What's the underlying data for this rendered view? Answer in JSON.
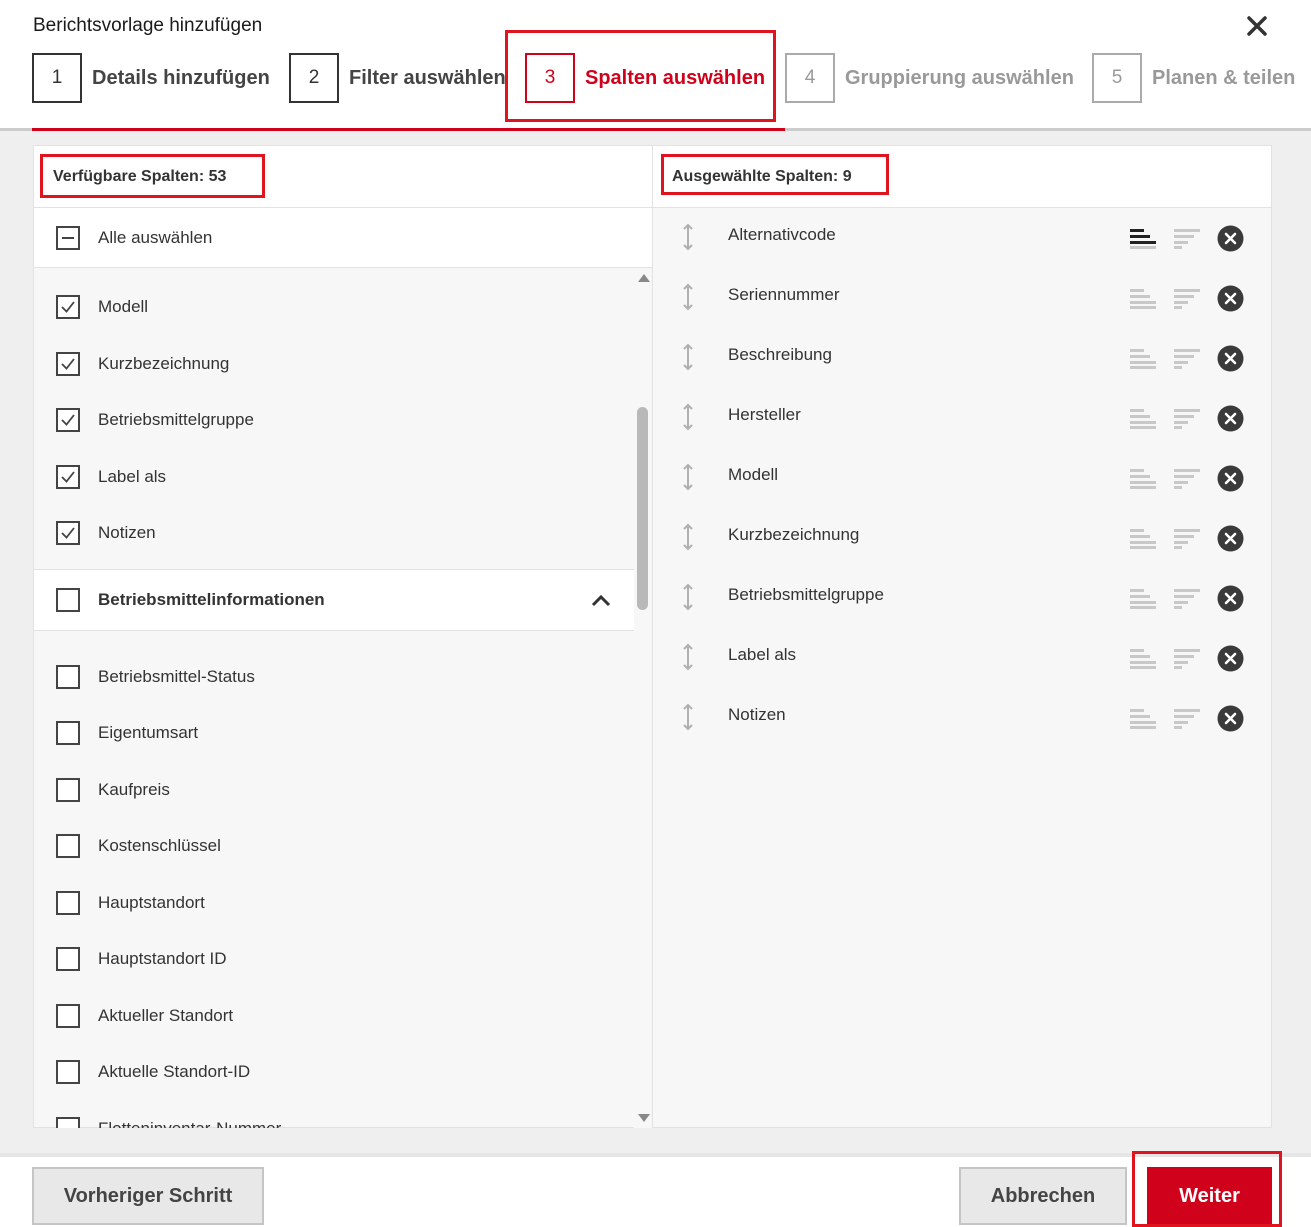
{
  "dialog": {
    "title": "Berichtsvorlage hinzufügen"
  },
  "steps": [
    {
      "num": "1",
      "label": "Details hinzufügen"
    },
    {
      "num": "2",
      "label": "Filter auswählen"
    },
    {
      "num": "3",
      "label": "Spalten auswählen"
    },
    {
      "num": "4",
      "label": "Gruppierung auswählen"
    },
    {
      "num": "5",
      "label": "Planen & teilen"
    }
  ],
  "available": {
    "header": "Verfügbare Spalten: 53",
    "select_all": "Alle auswählen",
    "checked_items": [
      "Modell",
      "Kurzbezeichnung",
      "Betriebsmittelgruppe",
      "Label als",
      "Notizen"
    ],
    "group": "Betriebsmittelinformationen",
    "unchecked_items": [
      "Betriebsmittel-Status",
      "Eigentumsart",
      "Kaufpreis",
      "Kostenschlüssel",
      "Hauptstandort",
      "Hauptstandort ID",
      "Aktueller Standort",
      "Aktuelle Standort-ID",
      "Flotteninventar-Nummer"
    ]
  },
  "selected": {
    "header": "Ausgewählte Spalten: 9",
    "items": [
      "Alternativcode",
      "Seriennummer",
      "Beschreibung",
      "Hersteller",
      "Modell",
      "Kurzbezeichnung",
      "Betriebsmittelgruppe",
      "Label als",
      "Notizen"
    ]
  },
  "footer": {
    "prev": "Vorheriger Schritt",
    "cancel": "Abbrechen",
    "next": "Weiter"
  },
  "colors": {
    "accent": "#d0021b",
    "highlight": "#e0141e"
  }
}
